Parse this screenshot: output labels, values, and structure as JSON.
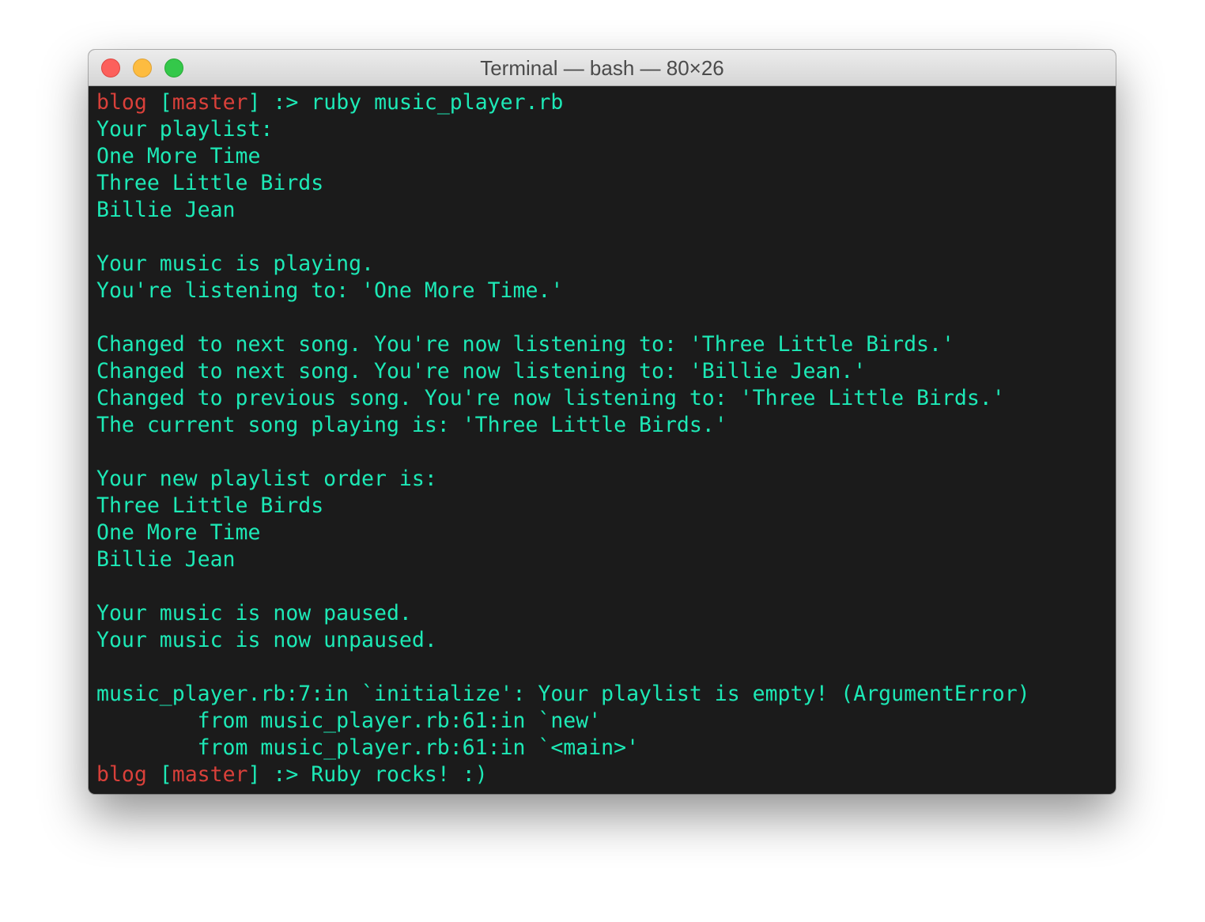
{
  "window": {
    "title": "Terminal — bash — 80×26",
    "colors": {
      "background": "#1b1b1b",
      "output_text": "#1de9b6",
      "prompt_text": "#d9403a"
    }
  },
  "terminal": {
    "prompt_dir": "blog",
    "prompt_open_bracket": "[",
    "prompt_branch": "master",
    "prompt_close_bracket": "]",
    "prompt_symbol": " :> ",
    "command": "ruby music_player.rb",
    "output": [
      "Your playlist:",
      "One More Time",
      "Three Little Birds",
      "Billie Jean",
      "",
      "Your music is playing.",
      "You're listening to: 'One More Time.'",
      "",
      "Changed to next song. You're now listening to: 'Three Little Birds.'",
      "Changed to next song. You're now listening to: 'Billie Jean.'",
      "Changed to previous song. You're now listening to: 'Three Little Birds.'",
      "The current song playing is: 'Three Little Birds.'",
      "",
      "Your new playlist order is:",
      "Three Little Birds",
      "One More Time",
      "Billie Jean",
      "",
      "Your music is now paused.",
      "Your music is now unpaused.",
      "",
      "music_player.rb:7:in `initialize': Your playlist is empty! (ArgumentError)",
      "        from music_player.rb:61:in `new'",
      "        from music_player.rb:61:in `<main>'"
    ],
    "final_prompt_input": "Ruby rocks! :)"
  }
}
